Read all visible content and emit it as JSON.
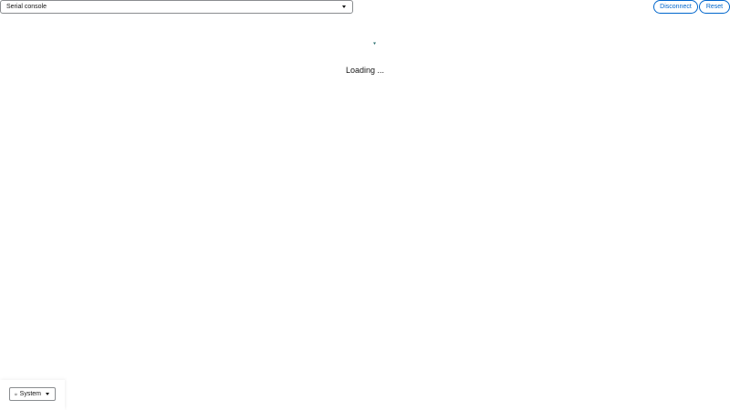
{
  "console": {
    "type_select_value": "Serial console"
  },
  "actions": {
    "disconnect_label": "Disconnect",
    "reset_label": "Reset"
  },
  "status": {
    "loading_text": "Loading ..."
  },
  "theme_switcher": {
    "label": "System",
    "icon": "monitor-icon"
  },
  "colors": {
    "accent": "#0066cc",
    "spinner": "#2a6f6f"
  }
}
